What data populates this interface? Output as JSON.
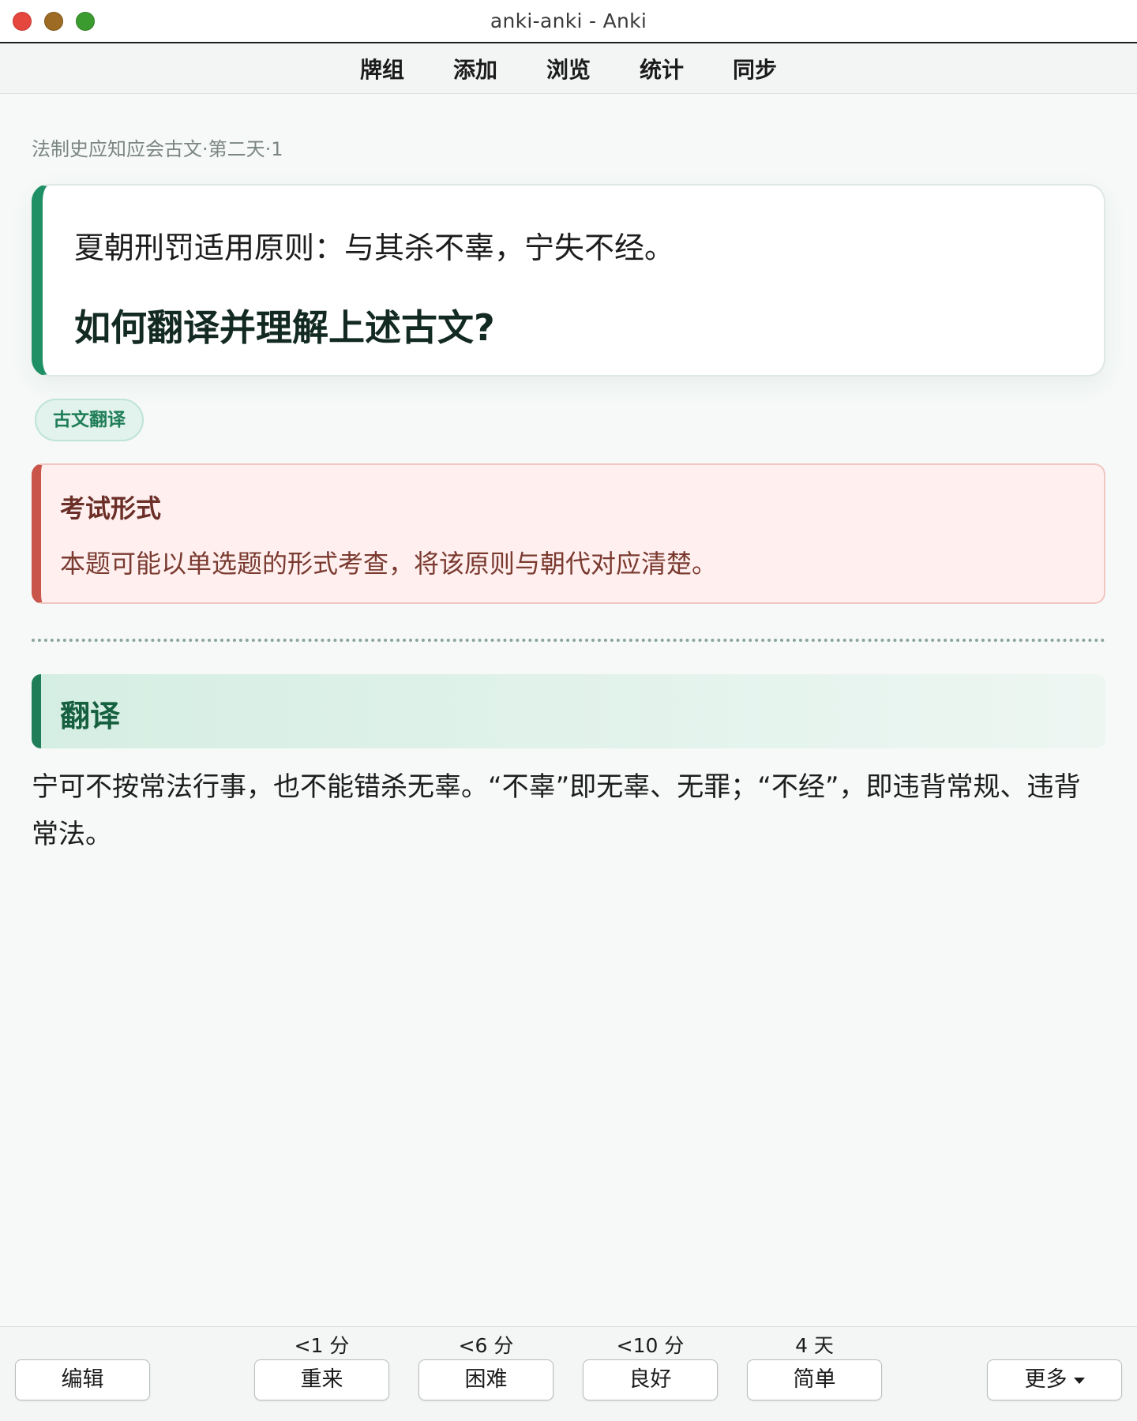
{
  "window": {
    "title": "anki-anki - Anki"
  },
  "toolbar": {
    "items": [
      "牌组",
      "添加",
      "浏览",
      "统计",
      "同步"
    ]
  },
  "card": {
    "deck_path": "法制史应知应会古文·第二天·1",
    "question_text": "夏朝刑罚适用原则：与其杀不辜，宁失不经。",
    "question_prompt": "如何翻译并理解上述古文?",
    "tag": "古文翻译",
    "exam": {
      "title": "考试形式",
      "body": "本题可能以单选题的形式考查，将该原则与朝代对应清楚。"
    },
    "translation": {
      "title": "翻译",
      "body": "宁可不按常法行事，也不能错杀无辜。“不辜”即无辜、无罪；“不经”，即违背常规、违背常法。"
    }
  },
  "answer_bar": {
    "edit_label": "编辑",
    "more_label": "更多",
    "buttons": [
      {
        "label": "重来",
        "interval": "<1 分"
      },
      {
        "label": "困难",
        "interval": "<6 分"
      },
      {
        "label": "良好",
        "interval": "<10 分"
      },
      {
        "label": "简单",
        "interval": "4 天"
      }
    ]
  },
  "colors": {
    "accent_green": "#1f8f66",
    "exam_red": "#c9544a",
    "background": "#f6f9f8"
  }
}
